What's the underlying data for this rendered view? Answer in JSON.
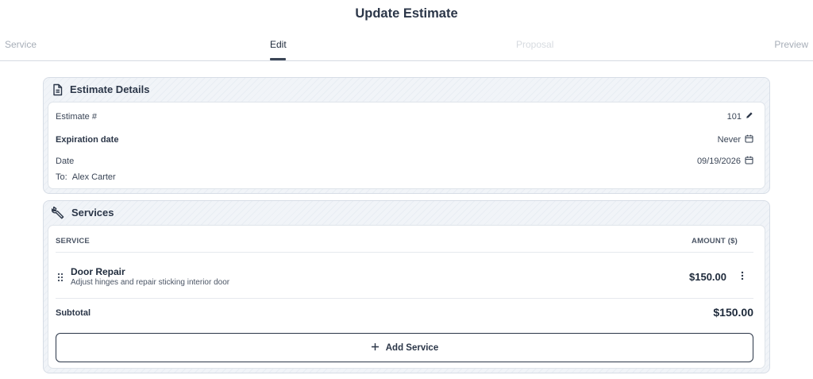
{
  "page": {
    "title": "Update Estimate"
  },
  "steps": [
    {
      "label": "Service"
    },
    {
      "label": "Edit"
    },
    {
      "label": "Proposal"
    },
    {
      "label": "Preview"
    }
  ],
  "estimate_details": {
    "heading": "Estimate Details",
    "icon": "document-icon",
    "estimate_number_label": "Estimate #",
    "estimate_number_value": "101",
    "expiration_label": "Expiration date",
    "expiration_value": "Never",
    "date_label": "Date",
    "date_value": "09/19/2026",
    "to_label": "To:",
    "to_value": "Alex Carter"
  },
  "services": {
    "heading": "Services",
    "icon": "wrench-icon",
    "col_service": "SERVICE",
    "col_amount": "AMOUNT ($)",
    "items": [
      {
        "name": "Door Repair",
        "description": "Adjust hinges and repair sticking interior door",
        "amount": "$150.00"
      }
    ],
    "subtotal_label": "Subtotal",
    "subtotal_value": "$150.00",
    "add_label": "Add Service"
  },
  "colors": {
    "primary": "#2b3648",
    "muted": "#a7aeb8",
    "card_bg": "#f1f4f8"
  }
}
